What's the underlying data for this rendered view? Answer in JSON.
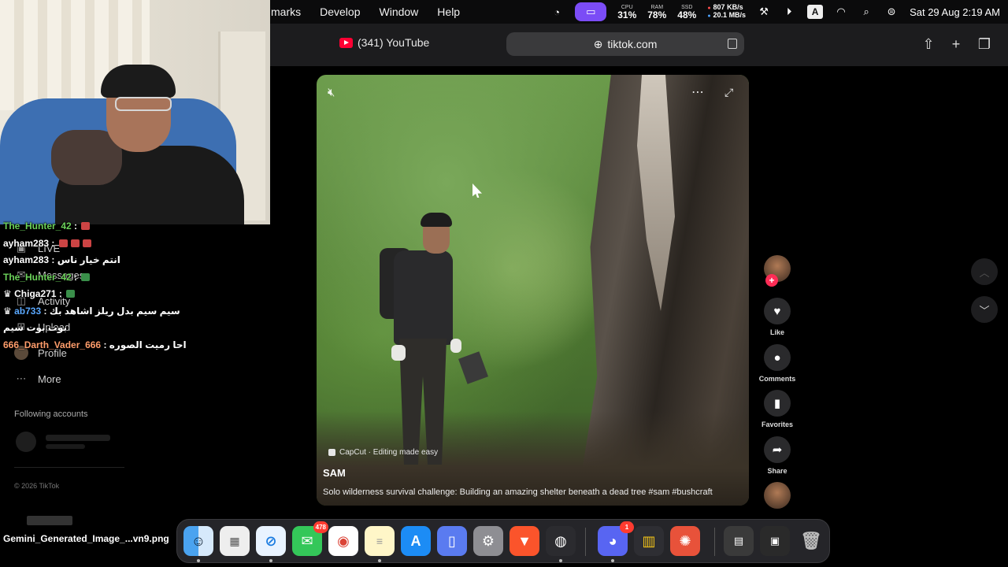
{
  "menubar": {
    "items": [
      "marks",
      "Develop",
      "Window",
      "Help"
    ],
    "cpu_label": "CPU",
    "cpu_value": "31%",
    "ram_label": "RAM",
    "ram_value": "78%",
    "ssd_label": "SSD",
    "ssd_value": "48%",
    "net_up": "807 KB/s",
    "net_down": "20.1 MB/s",
    "input_source": "A",
    "datetime": "Sat 29 Aug  2:19 AM"
  },
  "browser": {
    "tab_title": "(341) YouTube",
    "url": "tiktok.com"
  },
  "chat": [
    {
      "user": "The_Hunter_42",
      "msg": ":",
      "color": "green"
    },
    {
      "user": "ayham283",
      "msg": ":",
      "color": "white"
    },
    {
      "user": "ayham283",
      "msg": ": انتم خيار ناس",
      "color": "white"
    },
    {
      "user": "The_Hunter_42",
      "msg": ":",
      "color": "green"
    },
    {
      "user": "Chiga271",
      "msg": ":",
      "color": "white"
    },
    {
      "user": "ab733",
      "msg": ": سيم سيم  بدل ريلز اشاهد بك",
      "color": "blue"
    },
    {
      "user": "",
      "msg": "بوت بوت سيم",
      "color": "white"
    },
    {
      "user": "666_Darth_Vader_666",
      "msg": ": احا رميت الصوره",
      "color": "orange"
    }
  ],
  "sidebar": {
    "items": [
      "LIVE",
      "Messages",
      "Activity",
      "Upload",
      "Profile",
      "More"
    ],
    "following_header": "Following accounts",
    "copyright": "© 2026 TikTok"
  },
  "video": {
    "capcut": "CapCut · Editing made easy",
    "author": "SAM",
    "caption": "Solo wilderness survival challenge: Building an amazing shelter beneath a dead tree #sam #bushcraft"
  },
  "actions": {
    "like": "Like",
    "comments": "Comments",
    "favorites": "Favorites",
    "share": "Share"
  },
  "dock": {
    "messages_badge": "478",
    "discord_badge": "1"
  },
  "desktop": {
    "file_name": "Gemini_Generated_Image_...vn9.png"
  }
}
